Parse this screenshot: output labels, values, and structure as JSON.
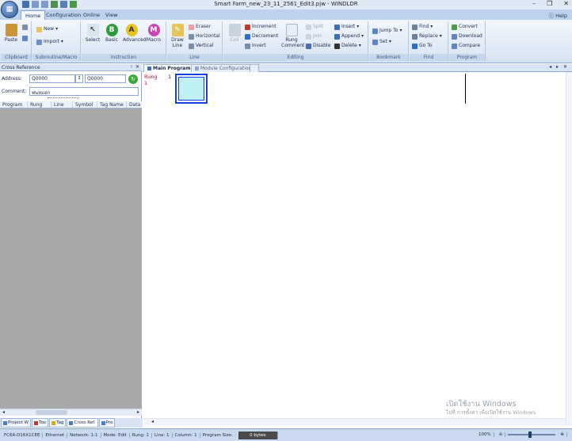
{
  "window": {
    "title": "Smart Farm_new_23_11_2561_Edit3.pjw - WINDLDR",
    "help": "Help"
  },
  "ribbon_tabs": [
    "Home",
    "Configuration",
    "Online",
    "View"
  ],
  "groups": {
    "clipboard": {
      "label": "Clipboard",
      "paste": "Paste"
    },
    "subroutine": {
      "label": "Subroutine/Macro",
      "new": "New",
      "import": "Import"
    },
    "instruction": {
      "label": "Instruction",
      "select": "Select",
      "basic": "Basic",
      "advanced": "Advanced",
      "macro": "Macro"
    },
    "line": {
      "label": "Line",
      "draw_line": "Draw Line",
      "eraser": "Eraser",
      "horizontal": "Horizontal",
      "vertical": "Vertical"
    },
    "editing": {
      "label": "Editing",
      "coil": "Coil",
      "increment": "Increment",
      "decrement": "Decrement",
      "invert": "Invert",
      "rung_comment": "Rung Comment",
      "split": "Split",
      "join": "Join",
      "disable": "Disable",
      "insert": "Insert",
      "append": "Append",
      "delete": "Delete"
    },
    "bookmark": {
      "label": "Bookmark",
      "jump_to": "Jump To",
      "set": "Set"
    },
    "find": {
      "label": "Find",
      "find": "Find",
      "replace": "Replace",
      "goto": "Go To"
    },
    "program": {
      "label": "Program",
      "convert": "Convert",
      "download": "Download",
      "compare": "Compare"
    }
  },
  "cross_reference": {
    "title": "Cross Reference",
    "address_label": "Address:",
    "address_from": "Q0000",
    "address_to": "Q0000",
    "comment_label": "Comment:",
    "comment_value": "พ่นหมอก",
    "columns": [
      "Program",
      "Rung",
      "Line",
      "Symbol",
      "Tag Name",
      "Data"
    ]
  },
  "bottom_tabs": [
    "Project W",
    "Too",
    "Tag",
    "Cross Ref.",
    "Pro"
  ],
  "doc_tabs": [
    "Main Program",
    "Module Configuration"
  ],
  "ladder": {
    "rung_label": "Rung",
    "rung_number": "1",
    "line_number": "1"
  },
  "watermark": {
    "line1": "เปิดใช้งาน Windows",
    "line2": "ไปที่ การตั้งค่า เพื่อเปิดใช้งาน Windows"
  },
  "status": {
    "plc": "FC6A-D16X1CEE",
    "connection": "Ethernet",
    "network": "Network: 1:1",
    "mode": "Mode: Edit",
    "rung": "Rung: 1",
    "line": "Line: 1",
    "column": "Column: 1",
    "program_size_label": "Program Size:",
    "program_size": "0 bytes",
    "zoom": "100%"
  }
}
